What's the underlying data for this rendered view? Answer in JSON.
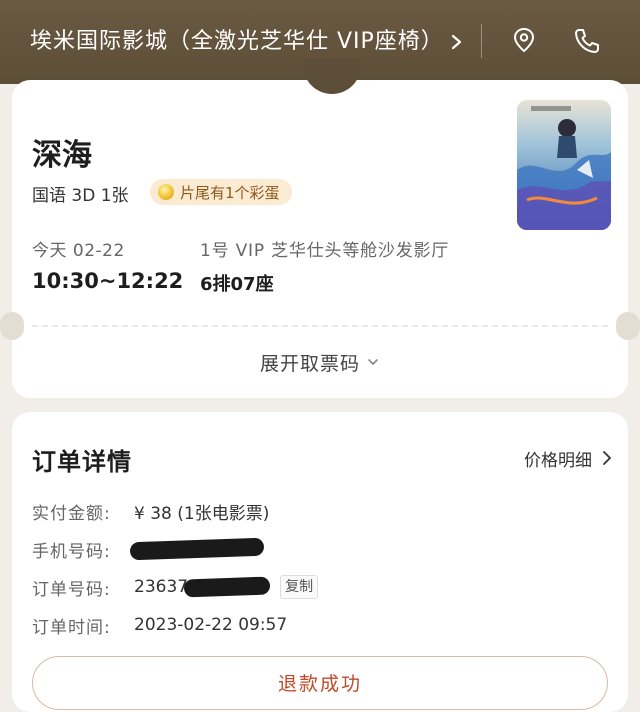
{
  "header": {
    "cinema_name": "埃米国际影城（全激光芝华仕 VIP座椅）",
    "icons": [
      "chevron-right-icon",
      "location-pin-icon",
      "phone-icon"
    ]
  },
  "ticket": {
    "movie_title": "深海",
    "meta": "国语 3D 1张",
    "egg_badge": "片尾有1个彩蛋",
    "date": "今天 02-22",
    "time": "10:30~12:22",
    "hall": "1号 VIP 芝华仕头等舱沙发影厅",
    "seat": "6排07座",
    "expand_label": "展开取票码"
  },
  "order": {
    "title": "订单详情",
    "price_detail_label": "价格明细",
    "rows": [
      {
        "label": "实付金额:",
        "value": "¥ 38 (1张电影票)"
      },
      {
        "label": "手机号码:",
        "value": ""
      },
      {
        "label": "订单号码:",
        "value": "23637"
      },
      {
        "label": "订单时间:",
        "value": "2023-02-22 09:57"
      }
    ],
    "copy_label": "复制",
    "refund_status": "退款成功"
  },
  "colors": {
    "header_bg": "#5d4e39",
    "refund_text": "#c24a28",
    "badge_bg": "#fcebd3"
  }
}
